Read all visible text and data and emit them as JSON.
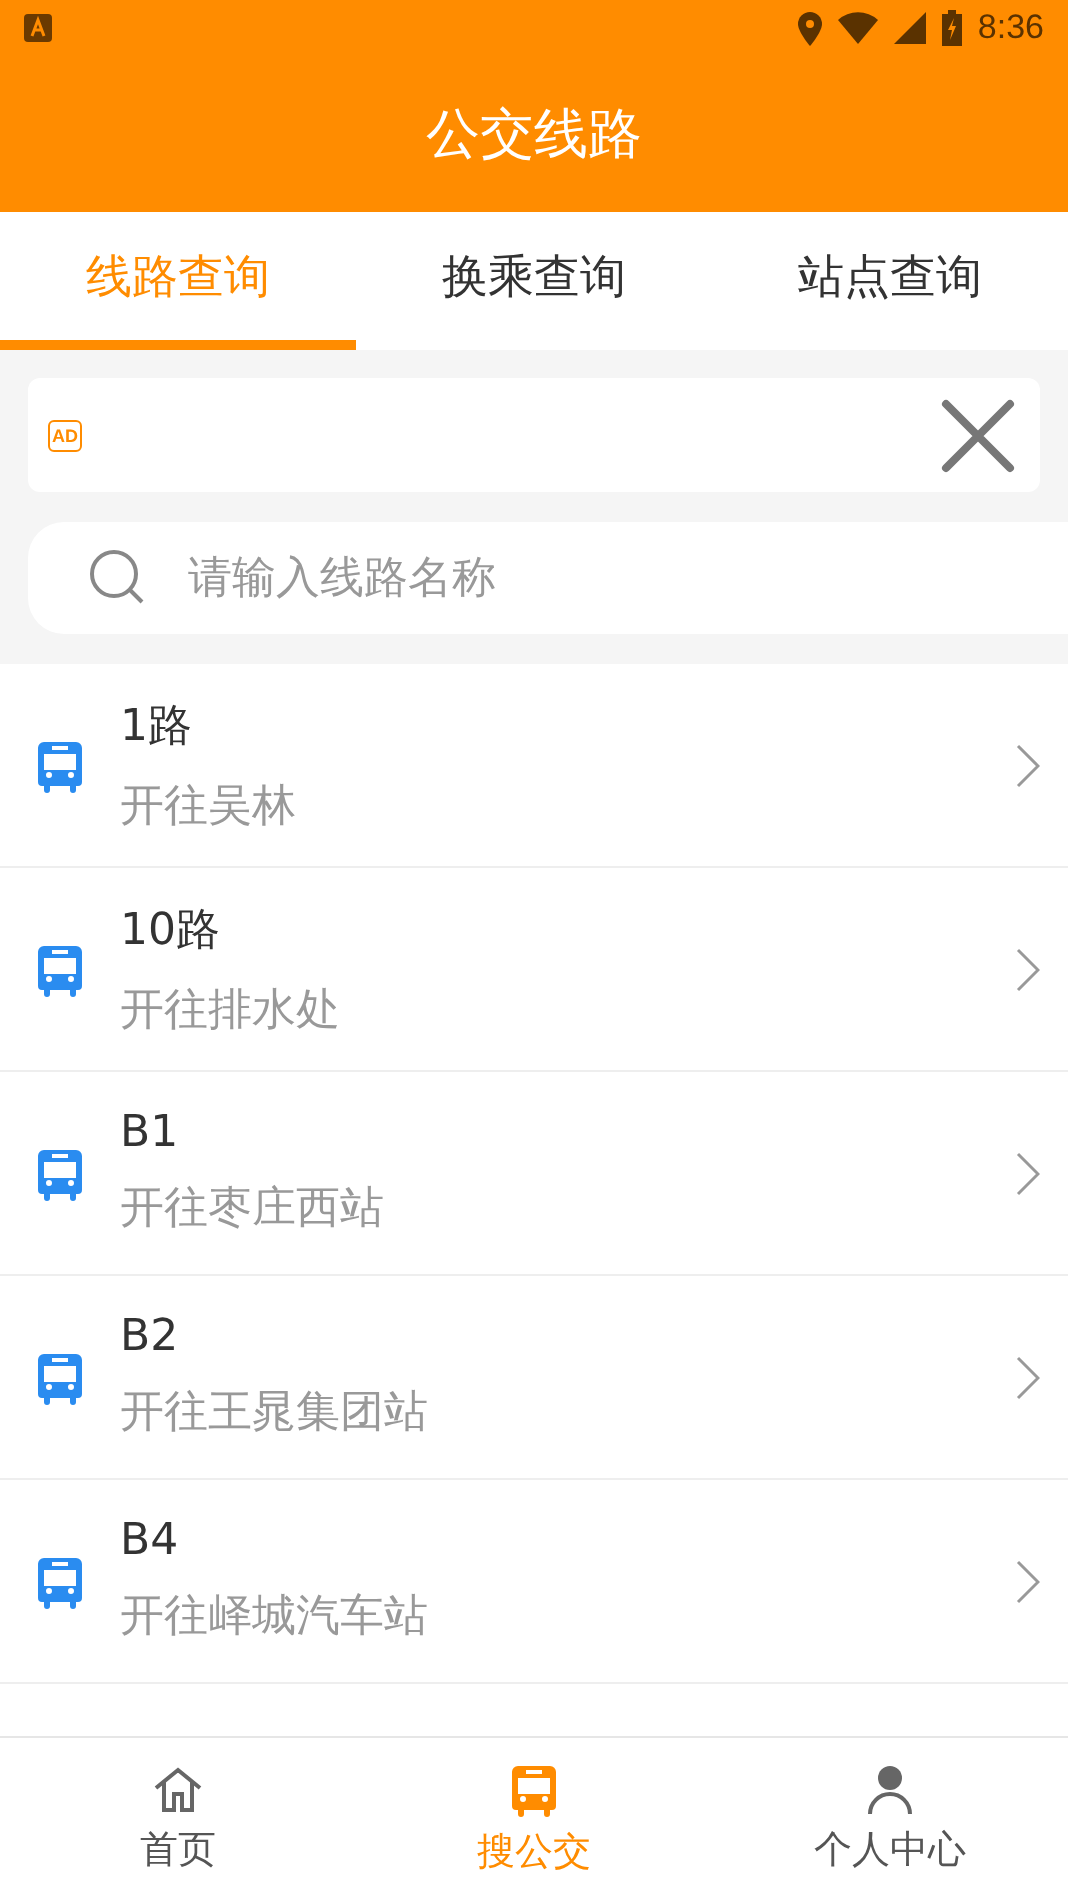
{
  "status_bar": {
    "time": "8:36"
  },
  "header": {
    "title": "公交线路"
  },
  "tabs": [
    {
      "label": "线路查询",
      "selected": true
    },
    {
      "label": "换乘查询",
      "selected": false
    },
    {
      "label": "站点查询",
      "selected": false
    }
  ],
  "ad": {
    "badge": "AD"
  },
  "search": {
    "placeholder": "请输入线路名称"
  },
  "routes": [
    {
      "name": "1路",
      "direction": "开往吴林"
    },
    {
      "name": "10路",
      "direction": "开往排水处"
    },
    {
      "name": "B1",
      "direction": "开往枣庄西站"
    },
    {
      "name": "B2",
      "direction": "开往王晁集团站"
    },
    {
      "name": "B4",
      "direction": "开往峄城汽车站"
    }
  ],
  "bottom_nav": [
    {
      "label": "首页",
      "kind": "home",
      "selected": false
    },
    {
      "label": "搜公交",
      "kind": "bus",
      "selected": true
    },
    {
      "label": "个人中心",
      "kind": "person",
      "selected": false
    }
  ]
}
